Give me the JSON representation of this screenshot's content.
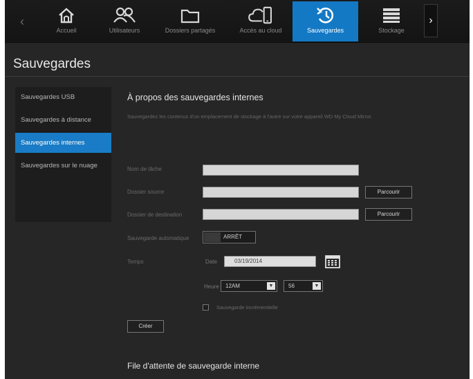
{
  "nav": {
    "items": [
      {
        "label": "Accueil",
        "icon": "home-icon"
      },
      {
        "label": "Utilisateurs",
        "icon": "users-icon"
      },
      {
        "label": "Dossiers partagés",
        "icon": "folder-icon"
      },
      {
        "label": "Accès au cloud",
        "icon": "cloud-device-icon"
      },
      {
        "label": "Sauvegardes",
        "icon": "backup-icon"
      },
      {
        "label": "Stockage",
        "icon": "storage-icon"
      }
    ],
    "active_index": 4,
    "prev_glyph": "‹",
    "next_glyph": "›"
  },
  "page": {
    "title": "Sauvegardes"
  },
  "sidebar": {
    "items": [
      {
        "label": "Sauvegardes USB"
      },
      {
        "label": "Sauvegardes à distance"
      },
      {
        "label": "Sauvegardes internes"
      },
      {
        "label": "Sauvegardes sur le nuage"
      }
    ],
    "active_index": 2
  },
  "main": {
    "title": "À propos des sauvegardes internes",
    "description": "Sauvegardez les contenus d'un emplacement de stockage à l'autre sur votre appareil WD My Cloud Mirror.",
    "form": {
      "task_name_label": "Nom de tâche",
      "task_name_value": "",
      "source_label": "Dossier source",
      "source_value": "",
      "destination_label": "Dossier de destination",
      "destination_value": "",
      "browse_label": "Parcourir",
      "auto_backup_label": "Sauvegarde automatique",
      "toggle_state": "ARRÊT",
      "time_label": "Temps",
      "date_label": "Date",
      "date_value": "03/19/2014",
      "hour_label": "Heure",
      "hour_value": "12AM",
      "minute_value": "56",
      "schedule_checkbox_label": "Sauvegarde incrémentielle",
      "schedule_checked": false,
      "create_label": "Créer"
    },
    "queue_title": "File d'attente de sauvegarde interne"
  },
  "colors": {
    "accent": "#1479c5",
    "background": "#262626",
    "nav_background": "#161616"
  }
}
